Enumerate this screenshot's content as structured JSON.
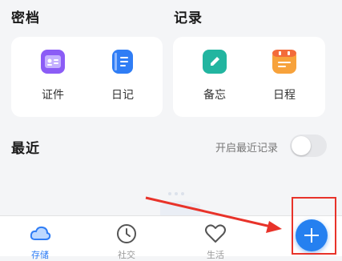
{
  "vault": {
    "title": "密档",
    "items": [
      {
        "label": "证件",
        "icon": "id-card-icon",
        "color": "#8b5cf6"
      },
      {
        "label": "日记",
        "icon": "diary-icon",
        "color": "#2f7df5"
      }
    ]
  },
  "records": {
    "title": "记录",
    "items": [
      {
        "label": "备忘",
        "icon": "memo-pencil-icon",
        "color": "#22b5a0"
      },
      {
        "label": "日程",
        "icon": "calendar-icon",
        "color": "#f7a23b"
      }
    ]
  },
  "recent": {
    "title": "最近",
    "toggle_label": "开启最近记录",
    "toggle_on": false
  },
  "tabbar": {
    "tabs": [
      {
        "label": "存储",
        "icon": "cloud-icon",
        "active": true
      },
      {
        "label": "社交",
        "icon": "clock-icon",
        "active": false
      },
      {
        "label": "生活",
        "icon": "heart-icon",
        "active": false
      }
    ],
    "fab_icon": "plus-icon"
  },
  "colors": {
    "accent": "#2580f0",
    "annotation": "#e8332a"
  }
}
